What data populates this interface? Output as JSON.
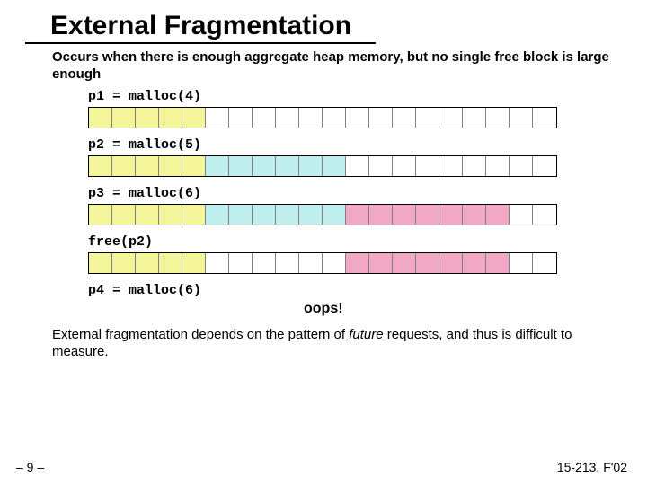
{
  "title": "External Fragmentation",
  "subtitle": "Occurs when there is enough aggregate heap memory, but no single free block is large enough",
  "steps": {
    "p1": "p1 = malloc(4)",
    "p2": "p2 = malloc(5)",
    "p3": "p3 = malloc(6)",
    "free": "free(p2)",
    "p4": "p4 = malloc(6)"
  },
  "oops": "oops!",
  "heap_size": 20,
  "heaps": {
    "row1": [
      "yellow",
      "yellow",
      "yellow",
      "yellow",
      "yellow",
      "empty",
      "empty",
      "empty",
      "empty",
      "empty",
      "empty",
      "empty",
      "empty",
      "empty",
      "empty",
      "empty",
      "empty",
      "empty",
      "empty",
      "empty"
    ],
    "row2": [
      "yellow",
      "yellow",
      "yellow",
      "yellow",
      "yellow",
      "cyan",
      "cyan",
      "cyan",
      "cyan",
      "cyan",
      "cyan",
      "empty",
      "empty",
      "empty",
      "empty",
      "empty",
      "empty",
      "empty",
      "empty",
      "empty"
    ],
    "row3": [
      "yellow",
      "yellow",
      "yellow",
      "yellow",
      "yellow",
      "cyan",
      "cyan",
      "cyan",
      "cyan",
      "cyan",
      "cyan",
      "pink",
      "pink",
      "pink",
      "pink",
      "pink",
      "pink",
      "pink",
      "empty",
      "empty"
    ],
    "row4": [
      "yellow",
      "yellow",
      "yellow",
      "yellow",
      "yellow",
      "empty",
      "empty",
      "empty",
      "empty",
      "empty",
      "empty",
      "pink",
      "pink",
      "pink",
      "pink",
      "pink",
      "pink",
      "pink",
      "empty",
      "empty"
    ]
  },
  "bottom_text_pre": "External fragmentation depends on the pattern of ",
  "bottom_text_future": "future",
  "bottom_text_post": " requests, and thus is difficult to measure.",
  "page_num": "– 9 –",
  "course": "15-213, F'02"
}
